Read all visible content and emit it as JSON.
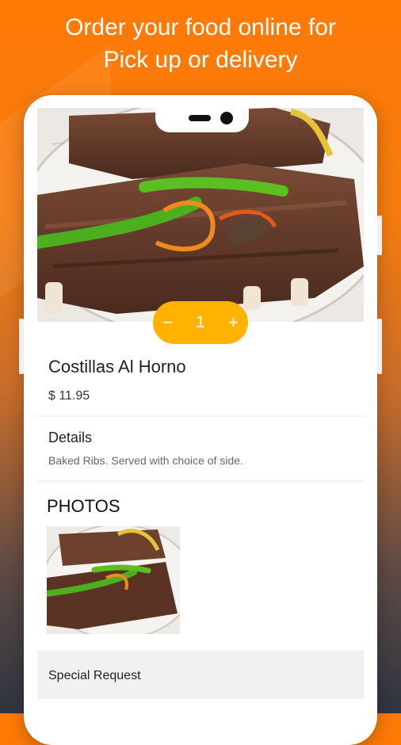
{
  "headline": {
    "line1": "Order your food online for",
    "line2": "Pick up or delivery"
  },
  "item": {
    "name": "Costillas Al Horno",
    "price": "$ 11.95",
    "quantity": "1",
    "minus_label": "−",
    "plus_label": "+"
  },
  "details": {
    "label": "Details",
    "text": "Baked Ribs. Served with choice of side."
  },
  "photos": {
    "label": "PHOTOS"
  },
  "special_request": {
    "label": "Special Request"
  },
  "colors": {
    "accent": "#ffb300",
    "brand_orange": "#ff7a06"
  },
  "icons": {
    "back": "arrow-left-icon"
  }
}
